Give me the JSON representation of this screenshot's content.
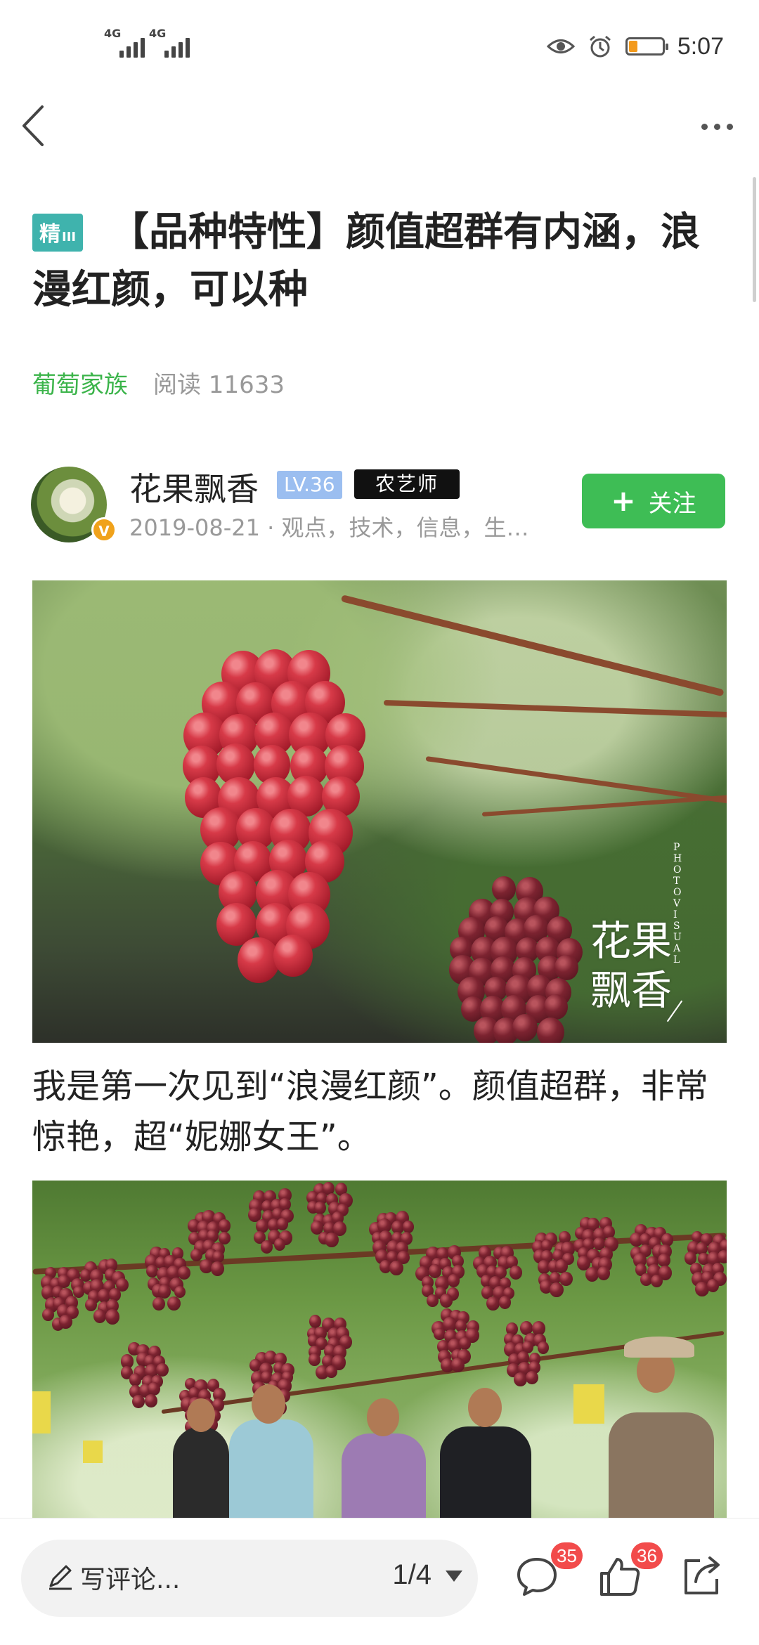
{
  "status_bar": {
    "signal1": "4G",
    "signal2": "4G",
    "time": "5:07",
    "icons": [
      "eye-icon",
      "alarm-icon",
      "battery-icon"
    ],
    "battery_color": "#f39a1c"
  },
  "nav": {
    "back_icon": "chevron-left-icon",
    "more_icon": "more-dots-icon"
  },
  "article": {
    "badge": "精",
    "badge_level": "III",
    "title": "【品种特性】颜值超群有内涵，浪漫红颜，可以种",
    "group": "葡萄家族",
    "reads": "阅读 11633"
  },
  "author": {
    "name": "花果飘香",
    "level": "LV.36",
    "role": "农艺师",
    "verified_mark": "V",
    "post_meta": "2019-08-21 · 观点，技术，信息，生…",
    "follow_label": "关注",
    "follow_color": "#3ebd55"
  },
  "content": {
    "image1_watermark_line1": "花果",
    "image1_watermark_line2": "飘香",
    "image1_watermark_small": "PHOTO VISUAL",
    "paragraph1": "我是第一次见到“浪漫红颜”。颜值超群，非常惊艳，超“妮娜女王”。"
  },
  "bottom_bar": {
    "comment_placeholder": "写评论...",
    "page_indicator": "1/4",
    "comment_count": "35",
    "like_count": "36",
    "icons": [
      "pen-icon",
      "comment-icon",
      "thumbs-up-icon",
      "share-icon"
    ]
  }
}
